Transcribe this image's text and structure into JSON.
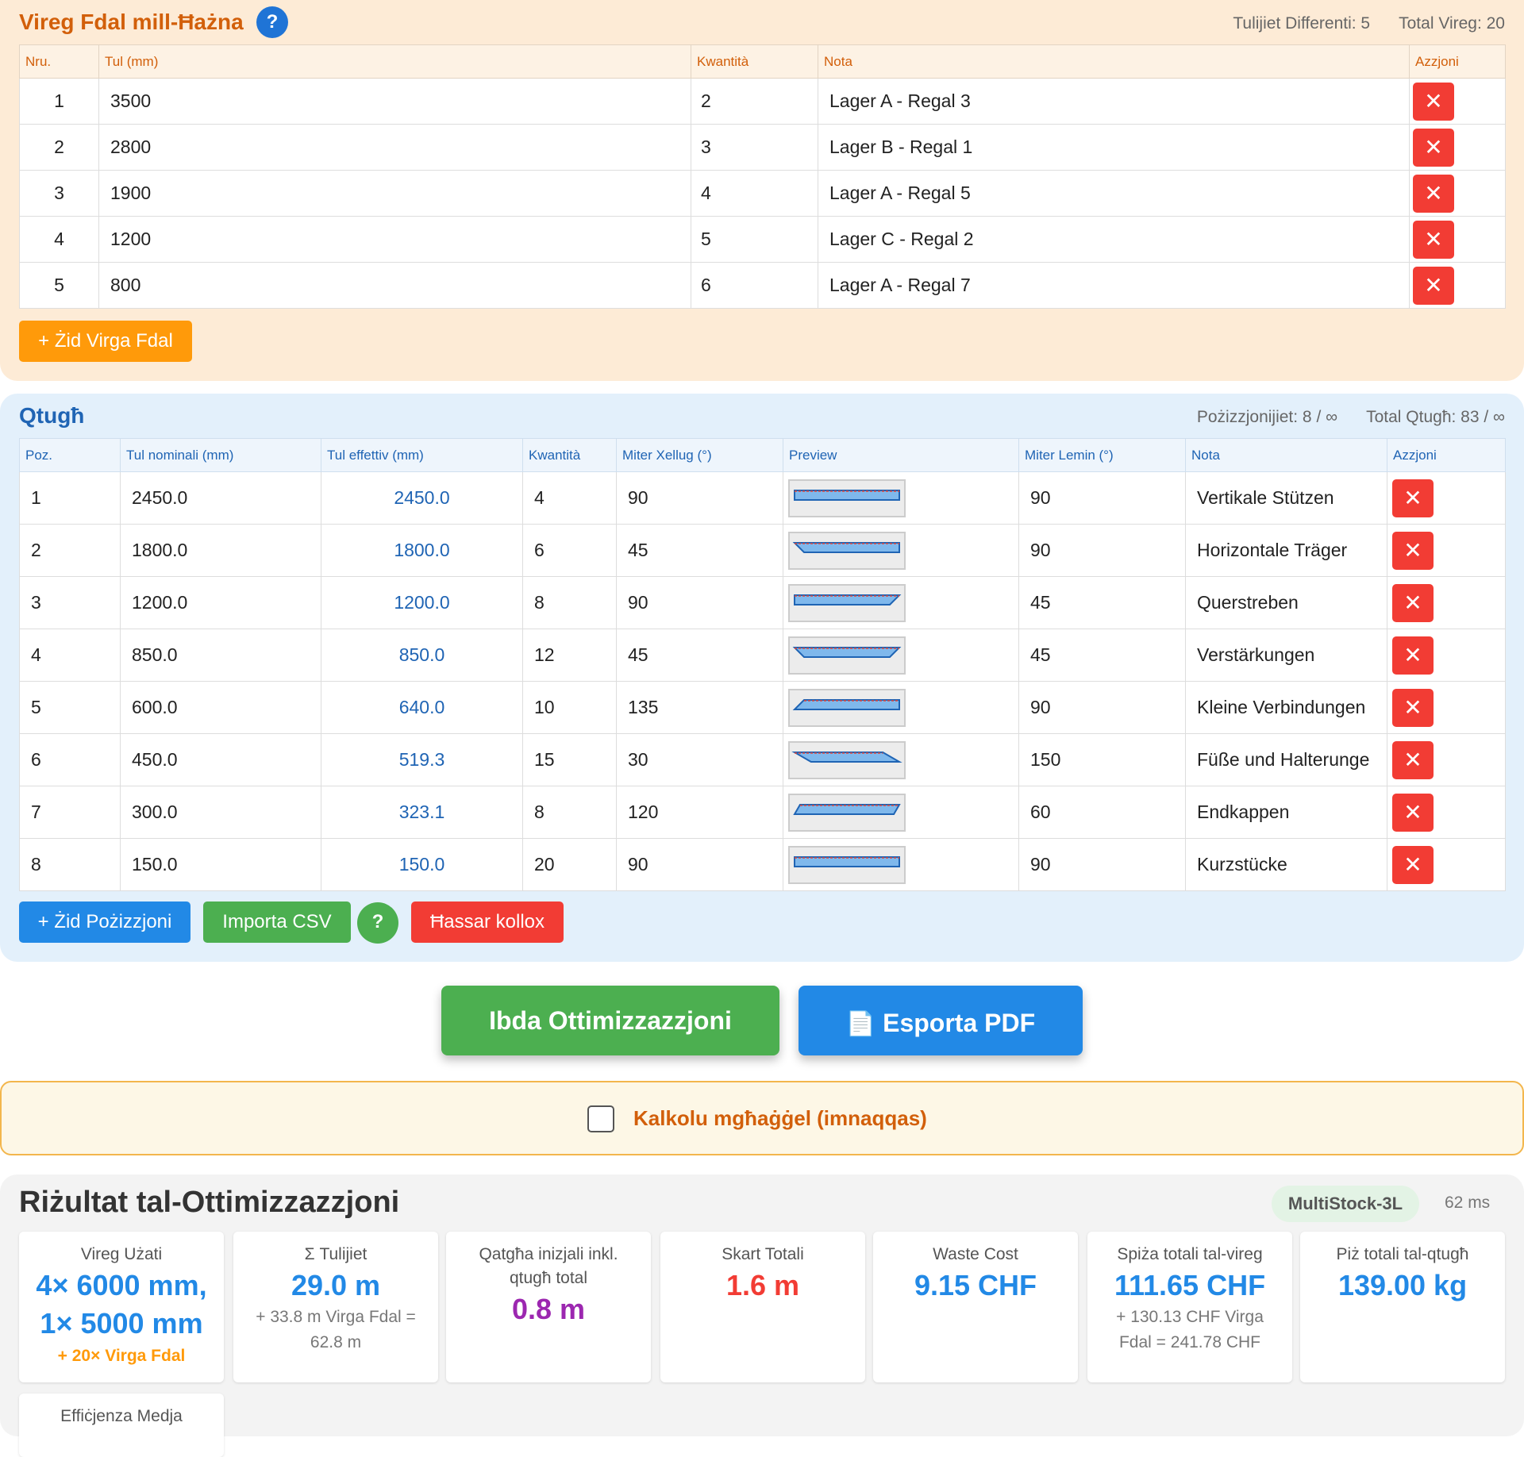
{
  "stock": {
    "title": "Vireg Fdal mill-Ħażna",
    "help": "?",
    "stat_lengths": "Tulijiet Differenti: 5",
    "stat_total": "Total Vireg: 20",
    "headers": [
      "Nru.",
      "Tul (mm)",
      "Kwantità",
      "Nota",
      "Azzjoni"
    ],
    "rows": [
      {
        "nr": "1",
        "length": "3500",
        "qty": "2",
        "note": "Lager A - Regal 3"
      },
      {
        "nr": "2",
        "length": "2800",
        "qty": "3",
        "note": "Lager B - Regal 1"
      },
      {
        "nr": "3",
        "length": "1900",
        "qty": "4",
        "note": "Lager A - Regal 5"
      },
      {
        "nr": "4",
        "length": "1200",
        "qty": "5",
        "note": "Lager C - Regal 2"
      },
      {
        "nr": "5",
        "length": "800",
        "qty": "6",
        "note": "Lager A - Regal 7"
      }
    ],
    "delete_glyph": "✕",
    "add_label": "+ Żid Virga Fdal"
  },
  "cuts": {
    "title": "Qtugħ",
    "stat_positions": "Pożizzjonijiet: 8 / ∞",
    "stat_total": "Total Qtugħ: 83 / ∞",
    "headers": [
      "Poz.",
      "Tul nominali (mm)",
      "Tul effettiv (mm)",
      "Kwantità",
      "Miter Xellug (°)",
      "Preview",
      "Miter Lemin (°)",
      "Nota",
      "Azzjoni"
    ],
    "rows": [
      {
        "pos": "1",
        "nominal": "2450.0",
        "effective": "2450.0",
        "qty": "4",
        "left": "90",
        "right": "90",
        "note": "Vertikale Stützen"
      },
      {
        "pos": "2",
        "nominal": "1800.0",
        "effective": "1800.0",
        "qty": "6",
        "left": "45",
        "right": "90",
        "note": "Horizontale Träger"
      },
      {
        "pos": "3",
        "nominal": "1200.0",
        "effective": "1200.0",
        "qty": "8",
        "left": "90",
        "right": "45",
        "note": "Querstreben"
      },
      {
        "pos": "4",
        "nominal": "850.0",
        "effective": "850.0",
        "qty": "12",
        "left": "45",
        "right": "45",
        "note": "Verstärkungen"
      },
      {
        "pos": "5",
        "nominal": "600.0",
        "effective": "640.0",
        "qty": "10",
        "left": "135",
        "right": "90",
        "note": "Kleine Verbindungen"
      },
      {
        "pos": "6",
        "nominal": "450.0",
        "effective": "519.3",
        "qty": "15",
        "left": "30",
        "right": "150",
        "note": "Füße und Halterunge"
      },
      {
        "pos": "7",
        "nominal": "300.0",
        "effective": "323.1",
        "qty": "8",
        "left": "120",
        "right": "60",
        "note": "Endkappen"
      },
      {
        "pos": "8",
        "nominal": "150.0",
        "effective": "150.0",
        "qty": "20",
        "left": "90",
        "right": "90",
        "note": "Kurzstücke"
      }
    ],
    "add_label": "+ Żid Pożizzjoni",
    "import_label": "Importa CSV",
    "help": "?",
    "clear_label": "Ħassar kollox"
  },
  "actions": {
    "optimize_label": "Ibda Ottimizzazzjoni",
    "pdf_icon": "📄",
    "pdf_label": "Esporta PDF"
  },
  "fast_calc": {
    "label": "Kalkolu mgħaġġel (imnaqqas)",
    "checked": false
  },
  "results": {
    "title": "Riżultat tal-Ottimizzazzjoni",
    "algorithm_badge": "MultiStock-3L",
    "time": "62 ms",
    "cards": [
      {
        "label": "Vireg Użati",
        "value_line1": "4× 6000 mm,",
        "value_line2": "1× 5000 mm",
        "extra": "+ 20× Virga Fdal"
      },
      {
        "label": "Σ Tulijiet",
        "value": "29.0 m",
        "sub_line1": "+ 33.8 m Virga Fdal =",
        "sub_line2": "62.8 m"
      },
      {
        "label_line1": "Qatgħa inizjali inkl.",
        "label_line2": "qtugħ total",
        "value": "0.8 m"
      },
      {
        "label": "Skart Totali",
        "value": "1.6 m"
      },
      {
        "label": "Waste Cost",
        "value": "9.15 CHF"
      },
      {
        "label": "Spiża totali tal-vireg",
        "value": "111.65 CHF",
        "sub_line1": "+ 130.13 CHF Virga",
        "sub_line2": "Fdal = 241.78 CHF"
      },
      {
        "label": "Piż totali tal-qtugħ",
        "value": "139.00 kg"
      },
      {
        "label": "Effiċjenza Medja"
      }
    ]
  },
  "colors": {
    "stock_accent": "#d25f0a",
    "cuts_accent": "#1f64b4",
    "delete_red": "#f23c34",
    "add_orange": "#ff9a0a",
    "add_blue": "#2289e6",
    "import_green": "#4caf50",
    "value_blue": "#2289e6",
    "value_purple": "#9c27b0",
    "value_red": "#f23c34",
    "extra_orange": "#ff9a0a"
  }
}
